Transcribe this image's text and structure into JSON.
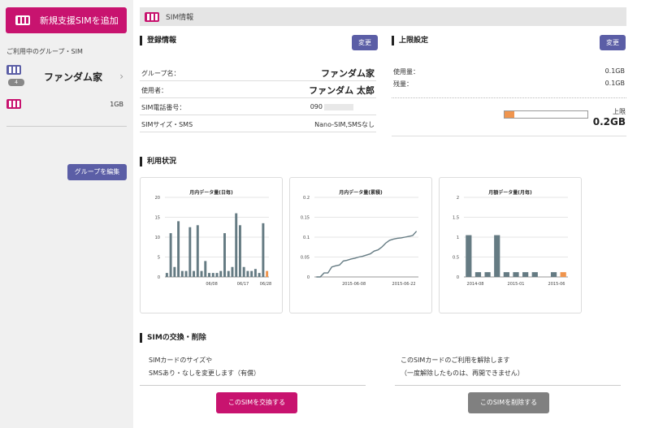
{
  "sidebar": {
    "add_sim_label": "新規支援SIMを追加",
    "caption": "ご利用中のグループ・SIM",
    "group": {
      "name": "ファンダム家",
      "badge": "4"
    },
    "sim": {
      "capacity": "1GB"
    },
    "edit_group_label": "グループを編集"
  },
  "header": {
    "title": "SIM情報"
  },
  "registration": {
    "heading": "登録情報",
    "edit_label": "変更",
    "rows": [
      {
        "key": "グループ名：",
        "value": "ファンダム家"
      },
      {
        "key": "使用者：",
        "value": "ファンダム 太郎"
      },
      {
        "key": "SIM電話番号：",
        "value": "090"
      },
      {
        "key": "SIMサイズ・SMS",
        "value": "Nano-SIM,SMSなし"
      }
    ]
  },
  "limit": {
    "heading": "上限設定",
    "edit_label": "変更",
    "used_label": "使用量：",
    "used_value": "0.1GB",
    "remaining_label": "残量：",
    "remaining_value": "0.1GB",
    "cap_label": "上限",
    "cap_value": "0.2GB",
    "usage_fraction": 0.12
  },
  "usage": {
    "heading": "利用状況"
  },
  "chart_data": [
    {
      "type": "bar",
      "title": "月内データ量(日毎)",
      "ylim": [
        0,
        20
      ],
      "yticks": [
        "0",
        "5",
        "10",
        "15",
        "20"
      ],
      "xticks": [
        "06/08",
        "06/17",
        "06/28"
      ],
      "values": [
        1,
        11,
        2.5,
        14,
        1.5,
        1.5,
        12.5,
        1.5,
        13,
        1.5,
        4,
        1,
        1,
        1,
        1.5,
        11,
        1.5,
        2.5,
        16,
        13,
        2.5,
        1.5,
        1.5,
        2,
        1,
        13.5,
        1.5
      ],
      "highlight_last": true,
      "colors": {
        "bar": "#657b83",
        "highlight": "#f0954e"
      }
    },
    {
      "type": "line",
      "title": "月内データ量(累積)",
      "ylim": [
        0,
        0.2
      ],
      "yticks": [
        "0",
        "0.05",
        "0.1",
        "0.15",
        "0.2"
      ],
      "xticks": [
        "2015-06-08",
        "2015-06-22"
      ],
      "values": [
        0,
        0,
        0.01,
        0.01,
        0.025,
        0.028,
        0.03,
        0.04,
        0.042,
        0.045,
        0.047,
        0.05,
        0.052,
        0.055,
        0.058,
        0.065,
        0.068,
        0.075,
        0.085,
        0.092,
        0.095,
        0.097,
        0.098,
        0.1,
        0.102,
        0.104,
        0.115
      ],
      "colors": {
        "line": "#657b83"
      }
    },
    {
      "type": "bar",
      "title": "月額データ量(月毎)",
      "ylim": [
        0,
        2
      ],
      "yticks": [
        "0",
        "0.5",
        "1",
        "1.5",
        "2"
      ],
      "xticks": [
        "2014-08",
        "2015-01",
        "2015-06"
      ],
      "values": [
        1.05,
        0.12,
        0.12,
        1.05,
        0.12,
        0.12,
        0.12,
        0.12,
        0,
        0.12,
        0.12
      ],
      "highlight_last": true,
      "colors": {
        "bar": "#657b83",
        "highlight": "#f0954e"
      }
    }
  ],
  "swap": {
    "heading": "SIMの交換・削除",
    "left_line1": "SIMカードのサイズや",
    "left_line2": "SMSあり・なしを変更します（有償）",
    "right_line1": "このSIMカードのご利用を解除します",
    "right_line2": "（一度解除したものは、再開できません）",
    "swap_button": "このSIMを交換する",
    "delete_button": "このSIMを削除する"
  },
  "colors": {
    "brand": "#c8136f",
    "button": "#5b5ea6",
    "disabled": "#808080",
    "accent": "#f0954e"
  }
}
